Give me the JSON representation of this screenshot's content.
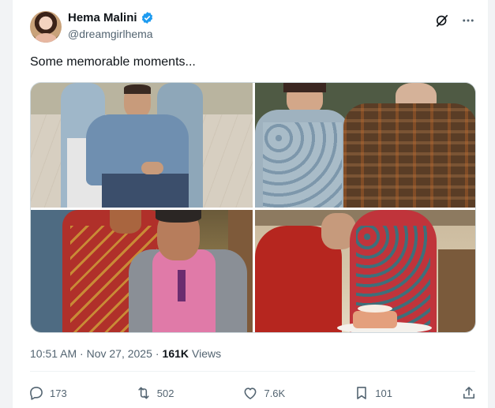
{
  "post": {
    "author": {
      "display_name": "Hema Malini",
      "handle": "@dreamgirlhema",
      "verified": true
    },
    "text": "Some memorable moments...",
    "timestamp": "10:51 AM · Nov 27, 2025",
    "views_count": "161K",
    "views_label": "Views"
  },
  "actions": {
    "replies": "173",
    "reposts": "502",
    "likes": "7.6K",
    "bookmarks": "101"
  },
  "icons": {
    "grok": "grok-icon",
    "more": "more-icon",
    "reply": "reply-icon",
    "repost": "repost-icon",
    "like": "like-icon",
    "bookmark": "bookmark-icon",
    "share": "share-icon"
  },
  "colors": {
    "text_primary": "#0f1419",
    "text_secondary": "#536471",
    "verified_blue": "#1d9bf0",
    "border": "#cfd9de"
  }
}
